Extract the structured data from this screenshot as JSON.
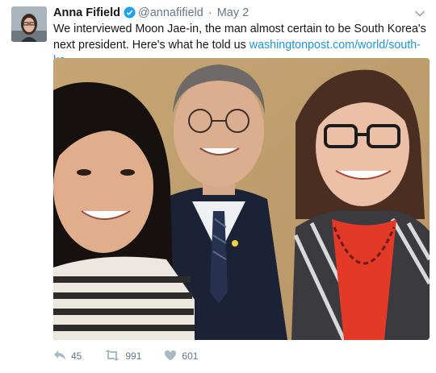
{
  "tweet": {
    "author_name": "Anna Fifield",
    "handle": "@annafifield",
    "separator": "·",
    "timestamp": "May 2",
    "text": "We interviewed Moon Jae-in, the man almost certain to be South Korea's next president. Here's what he told us",
    "link_text": "washingtonpost.com/world/south-ko…"
  },
  "actions": {
    "reply_count": "45",
    "retweet_count": "991",
    "like_count": "601"
  },
  "icons": {
    "verified": "verified-badge-icon",
    "caret": "chevron-down-icon",
    "reply": "reply-icon",
    "retweet": "retweet-icon",
    "like": "heart-icon"
  },
  "colors": {
    "link": "#1b95e0",
    "verified": "#1da1f2",
    "muted": "#657786",
    "text": "#14171a"
  }
}
